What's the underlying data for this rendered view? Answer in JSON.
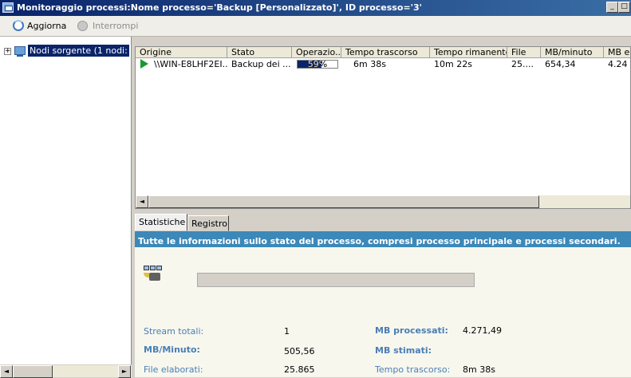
{
  "window": {
    "title": "Monitoraggio processi:Nome processo='Backup  [Personalizzato]', ID processo='3'",
    "minimize": "_",
    "maximize": "□"
  },
  "toolbar": {
    "refresh_label": "Aggiorna",
    "stop_label": "Interrompi"
  },
  "tree": {
    "expander": "+",
    "root_label": "Nodi sorgente (1 nodi:"
  },
  "grid": {
    "columns": [
      "Origine",
      "Stato",
      "Operazio...",
      "Tempo trascorso",
      "Tempo rimanente",
      "File",
      "MB/minuto",
      "MB e"
    ],
    "row": {
      "origine": "\\\\WIN-E8LHF2EI...",
      "stato": "Backup dei ...",
      "progress_text": "59%",
      "progress": 0.59,
      "tempo_trascorso": "6m 38s",
      "tempo_rimanente": "10m 22s",
      "file": "25....",
      "mb_minuto": "654,34",
      "mb_e": "4.24"
    }
  },
  "tabs": [
    "Statistiche",
    "Registro"
  ],
  "info": "Tutte le informazioni sullo stato del processo, compresi processo principale e processi secondari.",
  "stats": {
    "stream_label": "Stream totali:",
    "stream_value": "1",
    "mbmin_label": "MB/Minuto:",
    "mbmin_value": "505,56",
    "files_label": "File elaborati:",
    "files_value": "25.865",
    "mbproc_label": "MB processati:",
    "mbproc_value": "4.271,49",
    "mbest_label": "MB stimati:",
    "tempo_label": "Tempo trascorso:",
    "tempo_value": "8m 38s"
  },
  "scroll": {
    "left_arrow": "◄",
    "right_arrow": "►"
  }
}
